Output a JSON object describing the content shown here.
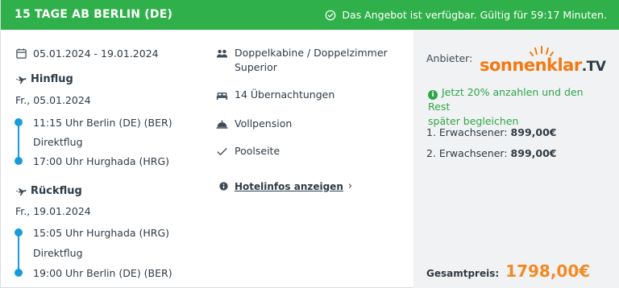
{
  "header": {
    "title": "15 TAGE AB BERLIN (DE)",
    "availability": "Das Angebot ist verfügbar. Gültig für 59:17 Minuten."
  },
  "trip": {
    "dates": "05.01.2024 - 19.01.2024",
    "outbound": {
      "label": "Hinflug",
      "date": "Fr., 05.01.2024",
      "departure": "11:15 Uhr Berlin (DE) (BER)",
      "type": "Direktflug",
      "arrival": "17:00 Uhr Hurghada (HRG)"
    },
    "return": {
      "label": "Rückflug",
      "date": "Fr., 19.01.2024",
      "departure": "15:05 Uhr Hurghada (HRG)",
      "type": "Direktflug",
      "arrival": "19:00 Uhr Berlin (DE) (BER)"
    }
  },
  "hotel": {
    "room_line1": "Doppelkabine / Doppelzimmer",
    "room_line2": "Superior",
    "nights": "14 Übernachtungen",
    "board": "Vollpension",
    "location": "Poolseite",
    "info_link": "Hotelinfos anzeigen"
  },
  "pricing": {
    "provider_label": "Anbieter:",
    "provider_logo_text": "sonnenklar",
    "provider_logo_suffix": ".TV",
    "promo_line1": "Jetzt 20% anzahlen und den Rest",
    "promo_line2": "später begleichen",
    "adults": [
      {
        "label": "1. Erwachsener:",
        "price": "899,00€"
      },
      {
        "label": "2. Erwachsener:",
        "price": "899,00€"
      }
    ],
    "total_label": "Gesamtpreis:",
    "total_price": "1798,00€"
  },
  "colors": {
    "header_bg": "#30b04a",
    "timeline": "#1a9bd7",
    "promo": "#2ea64a",
    "total_price": "#f28a24",
    "logo_orange": "#f27a13"
  }
}
